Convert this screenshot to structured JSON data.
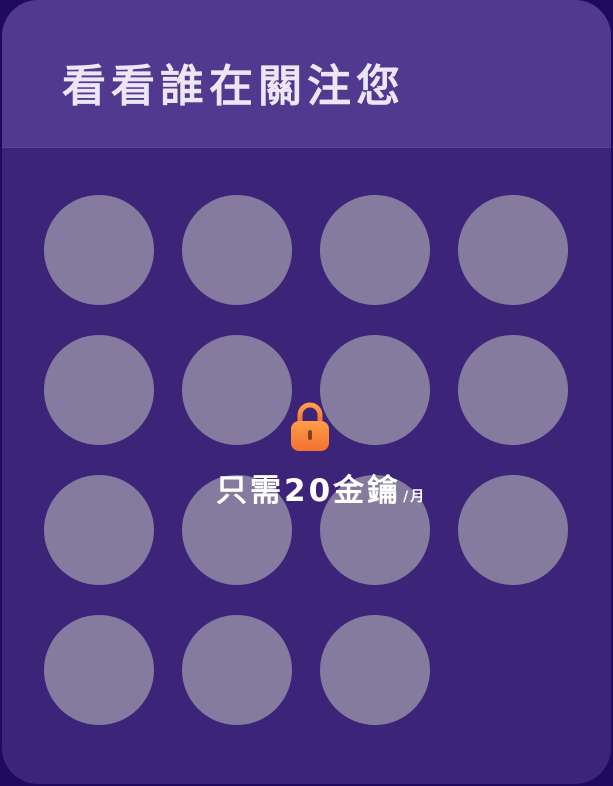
{
  "header": {
    "title": "看看誰在關注您"
  },
  "followers": {
    "count": 15
  },
  "lock": {
    "icon": "lock-icon",
    "color_top": "#ff9e4a",
    "color_bottom": "#f3702f"
  },
  "price": {
    "main": "只需20金鑰",
    "unit": "/月"
  },
  "colors": {
    "card_background": "#3c2479",
    "header_background": "#51398f",
    "avatar_placeholder": "#857b9f"
  }
}
